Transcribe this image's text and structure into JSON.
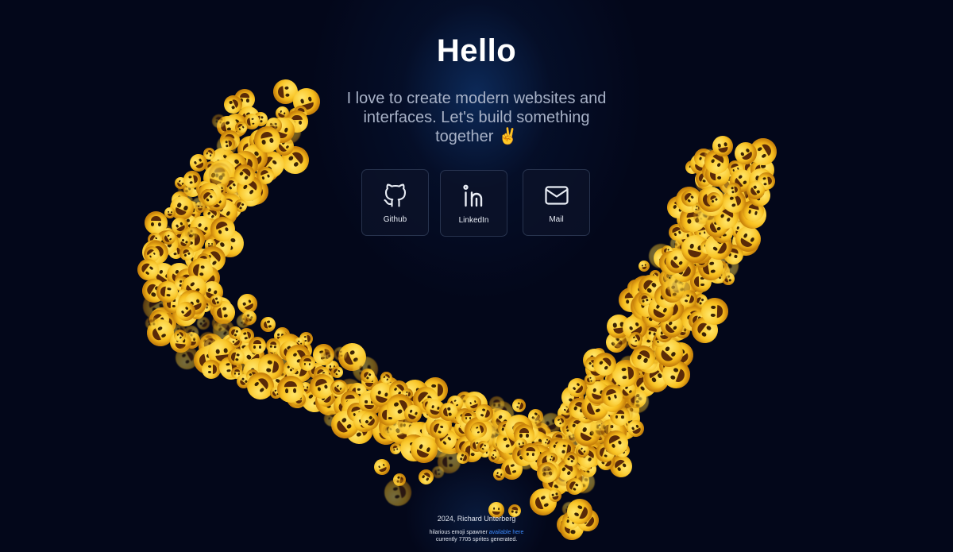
{
  "hero": {
    "title": "Hello",
    "subtitle": "I love to create modern websites and interfaces. Let's build something together ✌️"
  },
  "links": [
    {
      "label": "Github",
      "icon": "github-icon"
    },
    {
      "label": "LinkedIn",
      "icon": "linkedin-icon"
    },
    {
      "label": "Mail",
      "icon": "mail-icon"
    }
  ],
  "footer": {
    "copyright": "2024, Richard Unterberg",
    "spawner_prefix": "hilarious emoji spawner",
    "spawner_link": "available here",
    "sprites_line": "currently 7705 sprites generated."
  },
  "colors": {
    "background": "#03071a",
    "emoji_yellow": "#f9c322",
    "link_blue": "#3d8bff",
    "text_light": "#e8ecf4"
  },
  "decor": {
    "emoji_swarm": "crying-laughing-face-icon"
  }
}
